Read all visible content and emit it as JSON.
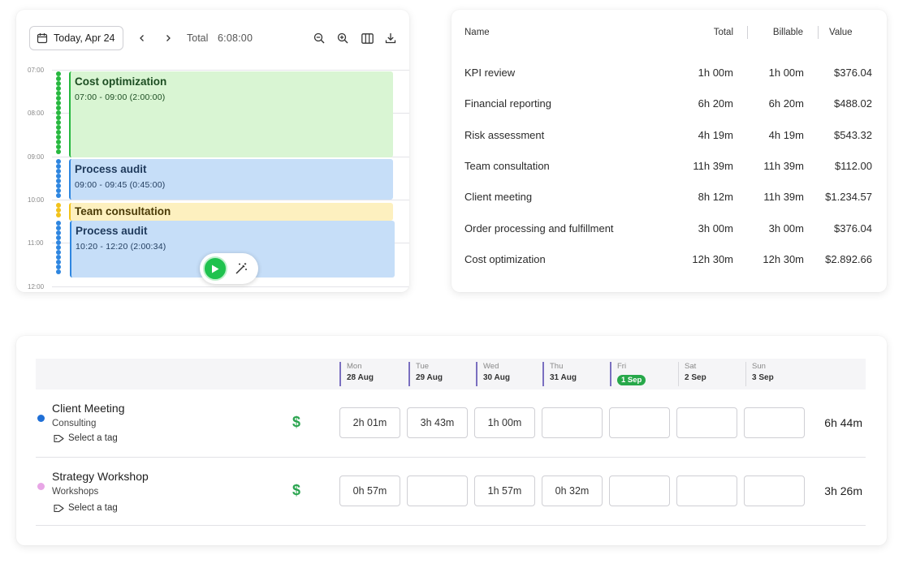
{
  "calendar": {
    "date_label": "Today, Apr 24",
    "total_label": "Total",
    "total_value": "6:08:00",
    "hours": [
      "07:00",
      "08:00",
      "09:00",
      "10:00",
      "11:00",
      "12:00"
    ],
    "events": [
      {
        "title": "Cost optimization",
        "time": "07:00 - 09:00  (2:00:00)",
        "bg": "#d9f5d3",
        "border": "#27b83f",
        "text": "#1c4d22"
      },
      {
        "title": "Process audit",
        "time": "09:00 - 09:45  (0:45:00)",
        "bg": "#c6def8",
        "border": "#2e86e0",
        "text": "#1f3a5c"
      },
      {
        "title": "Team consultation",
        "time": "",
        "bg": "#fdf0bf",
        "border": "#f2c21b",
        "text": "#4a3a06"
      },
      {
        "title": "Process audit",
        "time": "10:20 - 12:20  (2:00:34)",
        "bg": "#c6def8",
        "border": "#2e86e0",
        "text": "#1f3a5c"
      }
    ]
  },
  "report": {
    "headers": {
      "name": "Name",
      "total": "Total",
      "billable": "Billable",
      "value": "Value"
    },
    "rows": [
      {
        "name": "KPI review",
        "total": "1h 00m",
        "billable": "1h 00m",
        "value": "$376.04"
      },
      {
        "name": "Financial reporting",
        "total": "6h 20m",
        "billable": "6h 20m",
        "value": "$488.02"
      },
      {
        "name": "Risk assessment",
        "total": "4h 19m",
        "billable": "4h 19m",
        "value": "$543.32"
      },
      {
        "name": "Team consultation",
        "total": "11h 39m",
        "billable": "11h 39m",
        "value": "$112.00"
      },
      {
        "name": "Client meeting",
        "total": "8h 12m",
        "billable": "11h 39m",
        "value": "$1.234.57"
      },
      {
        "name": "Order processing and fulfillment",
        "total": "3h 00m",
        "billable": "3h 00m",
        "value": "$376.04"
      },
      {
        "name": "Cost optimization",
        "total": "12h 30m",
        "billable": "12h 30m",
        "value": "$2.892.66"
      }
    ]
  },
  "timesheet": {
    "days": [
      {
        "name": "Mon",
        "date": "28 Aug",
        "marked": true,
        "today": false
      },
      {
        "name": "Tue",
        "date": "29 Aug",
        "marked": true,
        "today": false
      },
      {
        "name": "Wed",
        "date": "30 Aug",
        "marked": true,
        "today": false
      },
      {
        "name": "Thu",
        "date": "31 Aug",
        "marked": true,
        "today": false
      },
      {
        "name": "Fri",
        "date": "1 Sep",
        "marked": true,
        "today": true
      },
      {
        "name": "Sat",
        "date": "2 Sep",
        "marked": false,
        "today": false
      },
      {
        "name": "Sun",
        "date": "3 Sep",
        "marked": false,
        "today": false
      }
    ],
    "rows": [
      {
        "project": "Client Meeting",
        "client": "Consulting",
        "tag": "Select a tag",
        "dot_color": "#1f6fd6",
        "billable_symbol": "$",
        "cells": [
          "2h 01m",
          "3h 43m",
          "1h 00m",
          "",
          "",
          "",
          ""
        ],
        "total": "6h 44m"
      },
      {
        "project": "Strategy Workshop",
        "client": "Workshops",
        "tag": "Select a tag",
        "dot_color": "#e8a6e6",
        "billable_symbol": "$",
        "cells": [
          "0h 57m",
          "",
          "1h 57m",
          "0h 32m",
          "",
          "",
          ""
        ],
        "total": "3h 26m"
      }
    ]
  }
}
